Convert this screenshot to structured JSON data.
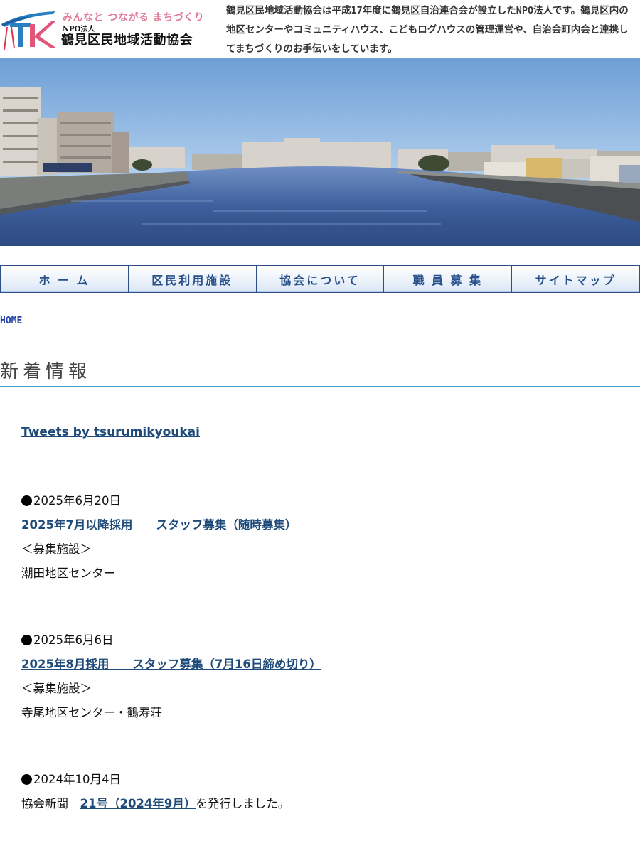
{
  "header": {
    "logo_tagline": "みんなと つながる まちづくり",
    "logo_npo": "NPO法人",
    "logo_name": "鶴見区民地域活動協会",
    "description": "鶴見区民地域活動協会は平成17年度に鶴見区自治連合会が設立したNPO法人です。鶴見区内の地区センターやコミュニティハウス、こどもログハウスの管理運営や、自治会町内会と連携してまちづくりのお手伝いをしています。"
  },
  "nav": {
    "items": [
      {
        "label": "ホ ー ム"
      },
      {
        "label": "区民利用施設"
      },
      {
        "label": "協会について"
      },
      {
        "label": "職 員 募 集"
      },
      {
        "label": "サイトマップ"
      }
    ]
  },
  "breadcrumb": "HOME",
  "section_title": "新着情報",
  "tweets_link": "Tweets by tsurumikyoukai",
  "news": [
    {
      "date": "2025年6月20日",
      "link": "2025年7月以降採用　　スタッフ募集（随時募集）",
      "label": "＜募集施設＞",
      "facility": "潮田地区センター"
    },
    {
      "date": "2025年6月6日",
      "link": "2025年8月採用　　スタッフ募集（7月16日締め切り）",
      "label": "＜募集施設＞",
      "facility": "寺尾地区センター・鶴寿荘"
    },
    {
      "date": "2024年10月4日",
      "prefix": "協会新聞　",
      "link": "21号（2024年9月）",
      "suffix": "を発行しました。"
    }
  ],
  "colors": {
    "nav_text": "#27508a",
    "link": "#1f4b7a",
    "title_rule": "#4aa3cf",
    "logo_pink": "#e07a96",
    "logo_blue": "#2a7fc1"
  }
}
